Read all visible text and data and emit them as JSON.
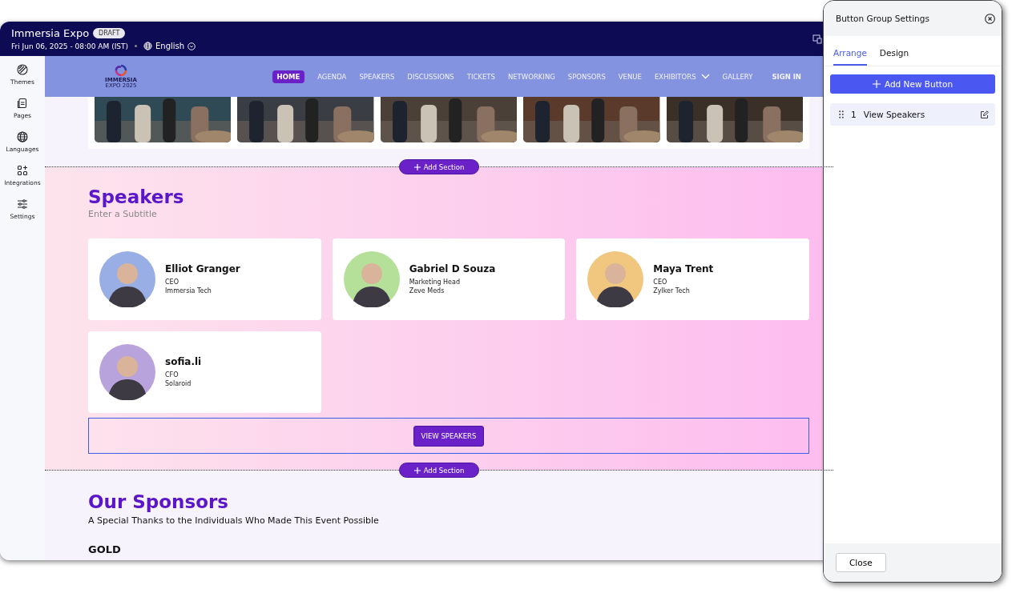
{
  "app": {
    "title": "Immersia Expo",
    "status": "DRAFT",
    "date": "Fri Jun 06, 2025 - 08:00 AM (IST)",
    "language": "English"
  },
  "sidebar": {
    "items": [
      {
        "label": "Themes",
        "kind": "palette"
      },
      {
        "label": "Pages",
        "kind": "document"
      },
      {
        "label": "Languages",
        "kind": "globe"
      },
      {
        "label": "Integrations",
        "kind": "blocks"
      },
      {
        "label": "Settings",
        "kind": "sliders"
      }
    ]
  },
  "site_nav": {
    "logo": "IMMERSIA",
    "logo_sub": "EXPO 2025",
    "items": [
      {
        "label": "HOME",
        "selected": true,
        "dropdown": false
      },
      {
        "label": "AGENDA",
        "selected": false,
        "dropdown": false
      },
      {
        "label": "SPEAKERS",
        "selected": false,
        "dropdown": false
      },
      {
        "label": "DISCUSSIONS",
        "selected": false,
        "dropdown": false
      },
      {
        "label": "TICKETS",
        "selected": false,
        "dropdown": false
      },
      {
        "label": "NETWORKING",
        "selected": false,
        "dropdown": false
      },
      {
        "label": "SPONSORS",
        "selected": false,
        "dropdown": false
      },
      {
        "label": "VENUE",
        "selected": false,
        "dropdown": false
      },
      {
        "label": "EXHIBITORS",
        "selected": false,
        "dropdown": true
      },
      {
        "label": "GALLERY",
        "selected": false,
        "dropdown": false
      }
    ],
    "sign_in": "SIGN IN"
  },
  "add_section": [
    "Add Section",
    "Add Section"
  ],
  "speakers": {
    "title": "Speakers",
    "subtitle": "Enter a Subtitle",
    "cards": [
      {
        "name": "Elliot Granger",
        "role": "CEO",
        "company": "Immersia Tech",
        "color": "#9aaee6"
      },
      {
        "name": "Gabriel D Souza",
        "role": "Marketing Head",
        "company": "Zeve Meds",
        "color": "#b5e09a"
      },
      {
        "name": "Maya Trent",
        "role": "CEO",
        "company": "Zylker Tech",
        "color": "#f1c77f"
      },
      {
        "name": "sofia.li",
        "role": "CFO",
        "company": "Solaroid",
        "color": "#b9a3dc"
      }
    ]
  },
  "button_group": {
    "selected": true,
    "buttons": [
      "VIEW SPEAKERS"
    ]
  },
  "sponsors": {
    "title": "Our Sponsors",
    "subtitle": "A Special Thanks to the Individuals Who Made This Event Possible",
    "tier": "GOLD"
  },
  "panel": {
    "title": "Button Group Settings",
    "tabs": [
      {
        "label": "Arrange",
        "selected": true
      },
      {
        "label": "Design",
        "selected": false
      }
    ],
    "add_button": "Add New Button",
    "buttons": [
      {
        "index": "1",
        "label": "View Speakers"
      }
    ],
    "close": "Close"
  }
}
